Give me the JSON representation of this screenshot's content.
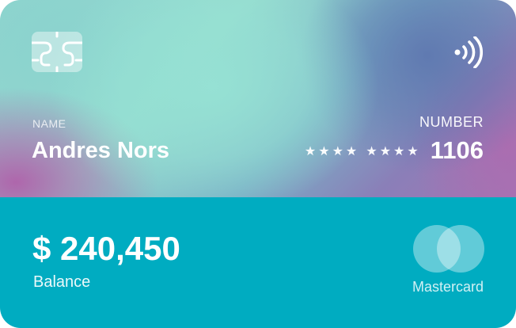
{
  "card": {
    "name_label": "NAME",
    "name": "Andres Nors",
    "number_label": "NUMBER",
    "number_mask": "★★★★ ★★★★",
    "number_last4": "1106",
    "balance": "$ 240,450",
    "balance_label": "Balance",
    "brand": "Mastercard"
  },
  "icons": {
    "chip": "chip-icon",
    "contactless": "contactless-icon",
    "brand_logo": "mastercard-logo-icon"
  },
  "colors": {
    "bottom_panel": "#00acc1",
    "text": "#ffffff",
    "gradient_teal": "#96dccf",
    "gradient_blue": "#5e78b0",
    "gradient_purple": "#b060aa"
  }
}
